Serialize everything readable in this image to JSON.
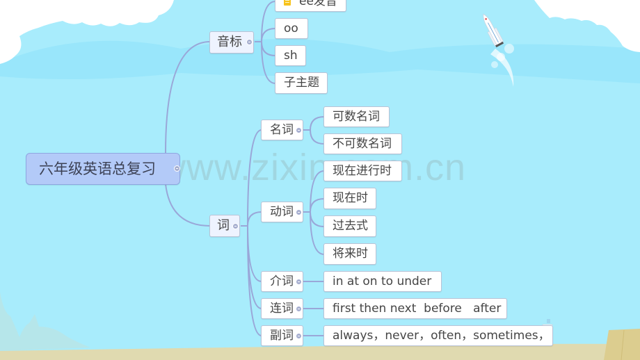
{
  "colors": {
    "sky": "#a8ecfc",
    "cloud": "#ffffff",
    "cloud_shadow": "#8fe3fb",
    "sand": "#e0dab0",
    "line": "#9aa7d8",
    "root_fill": "#b3caf8",
    "branch_fill": "#eef3ff",
    "note_icon": "#f7c31d"
  },
  "watermark": "www.zixin.com.cn",
  "mindmap": {
    "root": {
      "label": "六年级英语总复习"
    },
    "branches": [
      {
        "label": "音标",
        "children": [
          {
            "label": "ee发音",
            "icon": "note-icon"
          },
          {
            "label": "oo"
          },
          {
            "label": "sh"
          },
          {
            "label": "子主题"
          }
        ]
      },
      {
        "label": "词",
        "children": [
          {
            "label": "名词",
            "children": [
              {
                "label": "可数名词"
              },
              {
                "label": "不可数名词"
              }
            ]
          },
          {
            "label": "动词",
            "children": [
              {
                "label": "现在进行时"
              },
              {
                "label": "现在时"
              },
              {
                "label": "过去式"
              },
              {
                "label": "将来时"
              }
            ]
          },
          {
            "label": "介词",
            "children": [
              {
                "label": "in at on to under"
              }
            ]
          },
          {
            "label": "连词",
            "children": [
              {
                "label": "first then next  before   after"
              }
            ]
          },
          {
            "label": "副词",
            "children": [
              {
                "label": "always，never，often，sometimes，"
              }
            ]
          }
        ]
      }
    ]
  }
}
